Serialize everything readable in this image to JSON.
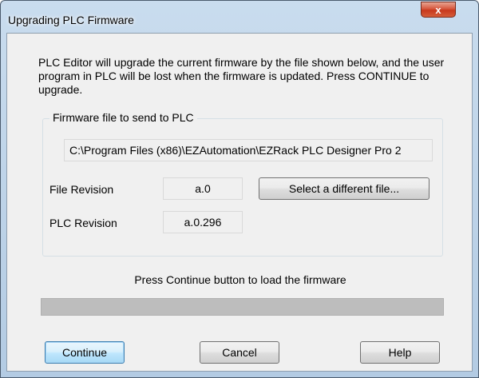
{
  "window": {
    "title": "Upgrading PLC Firmware",
    "close_glyph": "x"
  },
  "description": "PLC Editor will upgrade the current firmware by the file shown below, and the user program in PLC will be lost when the firmware is updated. Press CONTINUE to upgrade.",
  "firmware_group": {
    "legend": "Firmware file to send to PLC",
    "file_path": "C:\\Program Files (x86)\\EZAutomation\\EZRack PLC Designer Pro 2",
    "file_revision_label": "File Revision",
    "file_revision_value": "a.0",
    "plc_revision_label": "PLC Revision",
    "plc_revision_value": "a.0.296",
    "select_file_button": "Select a different file..."
  },
  "status_text": "Press Continue button to load the firmware",
  "progress": {
    "fraction": 0
  },
  "buttons": {
    "continue": "Continue",
    "cancel": "Cancel",
    "help": "Help"
  },
  "colors": {
    "close_button": "#c7381d",
    "dialog_background": "#f0f0f0",
    "progress_track": "#bdbdbd"
  },
  "icons": {
    "close": "close-icon"
  }
}
